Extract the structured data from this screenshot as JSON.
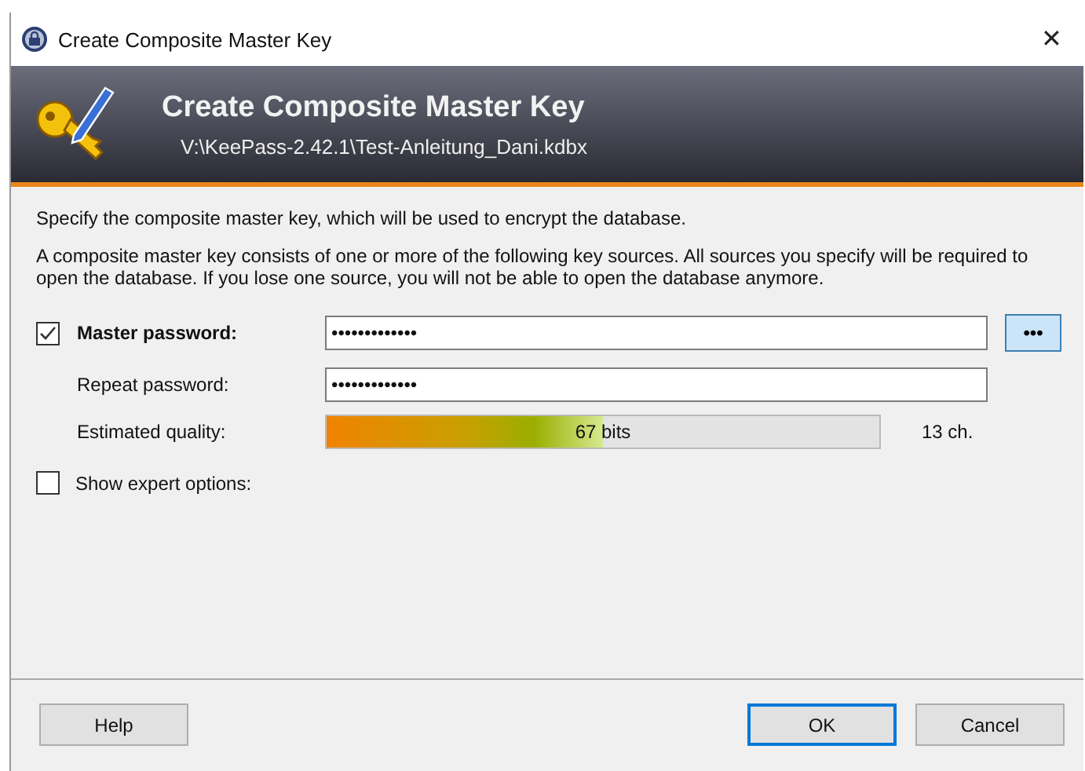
{
  "window": {
    "title": "Create Composite Master Key",
    "close": "✕"
  },
  "banner": {
    "title": "Create Composite Master Key",
    "path": "V:\\KeePass-2.42.1\\Test-Anleitung_Dani.kdbx"
  },
  "intro": "Specify the composite master key, which will be used to encrypt the database.",
  "description": "A composite master key consists of one or more of the following key sources. All sources you specify will be required to open the database. If you lose one source, you will not be able to open the database anymore.",
  "master_password": {
    "label": "Master password:",
    "checked": true,
    "value": "•••••••••••••",
    "toggle": "•••"
  },
  "repeat_password": {
    "label": "Repeat password:",
    "value": "•••••••••••••"
  },
  "quality": {
    "label": "Estimated quality:",
    "level": 0.5,
    "reading": "67 bits",
    "length": "13 ch."
  },
  "expert_options": {
    "label": "Show expert options:",
    "checked": false
  },
  "buttons": [
    {
      "label": "Help",
      "default": false
    },
    {
      "label": "OK",
      "default": true
    },
    {
      "label": "Cancel",
      "default": false
    }
  ]
}
